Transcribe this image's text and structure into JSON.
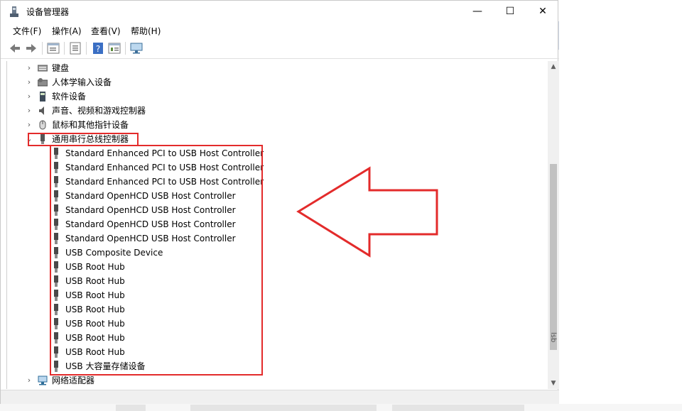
{
  "window": {
    "title": "设备管理器",
    "minimize": "—",
    "maximize": "☐",
    "close": "✕"
  },
  "menu": [
    "文件(F)",
    "操作(A)",
    "查看(V)",
    "帮助(H)"
  ],
  "toolbar": [
    "back-arrow-icon",
    "forward-arrow-icon",
    "tree-view-icon",
    "properties-icon",
    "help-icon",
    "details-view-icon",
    "monitor-icon"
  ],
  "tree": {
    "categories_top": [
      {
        "label": "键盘",
        "icon": "keyboard-icon",
        "expanded": false
      },
      {
        "label": "人体学输入设备",
        "icon": "hid-icon",
        "expanded": false
      },
      {
        "label": "软件设备",
        "icon": "software-device-icon",
        "expanded": false
      },
      {
        "label": "声音、视频和游戏控制器",
        "icon": "speaker-icon",
        "expanded": false
      },
      {
        "label": "鼠标和其他指针设备",
        "icon": "mouse-icon",
        "expanded": false
      },
      {
        "label": "通用串行总线控制器",
        "icon": "usb-icon",
        "expanded": true
      }
    ],
    "usb_devices": [
      "Standard Enhanced PCI to USB Host Controller",
      "Standard Enhanced PCI to USB Host Controller",
      "Standard Enhanced PCI to USB Host Controller",
      "Standard OpenHCD USB Host Controller",
      "Standard OpenHCD USB Host Controller",
      "Standard OpenHCD USB Host Controller",
      "Standard OpenHCD USB Host Controller",
      "USB Composite Device",
      "USB Root Hub",
      "USB Root Hub",
      "USB Root Hub",
      "USB Root Hub",
      "USB Root Hub",
      "USB Root Hub",
      "USB Root Hub",
      "USB 大容量存储设备"
    ],
    "categories_bottom": [
      {
        "label": "网络适配器",
        "icon": "network-adapter-icon",
        "expanded": false
      }
    ]
  },
  "side_text": "lsb",
  "colors": {
    "annotation": "#e32b2b"
  }
}
